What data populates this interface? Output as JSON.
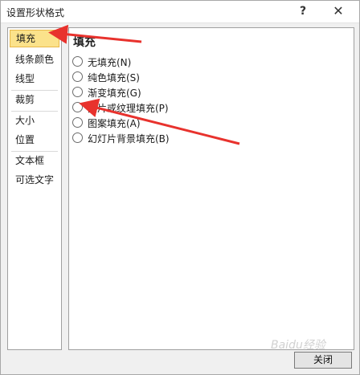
{
  "window": {
    "title": "设置形状格式",
    "help_label": "?",
    "close_label": "✕"
  },
  "sidebar": {
    "items": [
      {
        "label": "填充"
      },
      {
        "label": "线条颜色"
      },
      {
        "label": "线型"
      },
      {
        "label": "裁剪"
      },
      {
        "label": "大小"
      },
      {
        "label": "位置"
      },
      {
        "label": "文本框"
      },
      {
        "label": "可选文字"
      }
    ]
  },
  "fill": {
    "section_title": "填充",
    "options": [
      {
        "label": "无填充(N)"
      },
      {
        "label": "纯色填充(S)"
      },
      {
        "label": "渐变填充(G)"
      },
      {
        "label": "图片或纹理填充(P)"
      },
      {
        "label": "图案填充(A)"
      },
      {
        "label": "幻灯片背景填充(B)"
      }
    ]
  },
  "footer": {
    "close_button_label": "关闭",
    "watermark": "Baidu经验"
  },
  "colors": {
    "active_bg": "#fbe28b",
    "arrow": "#e8322d"
  }
}
